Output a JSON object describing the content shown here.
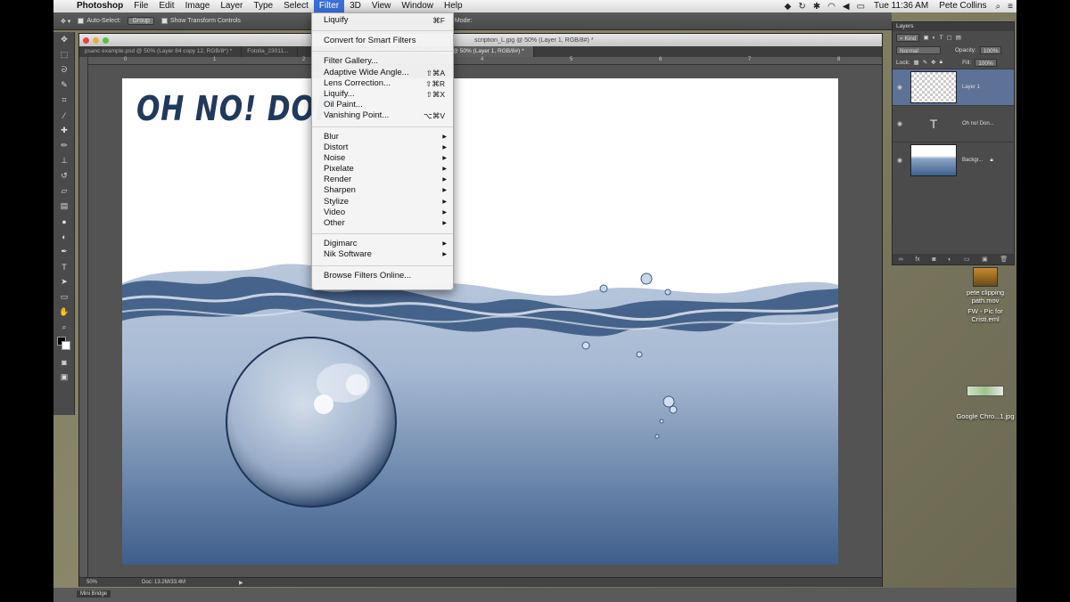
{
  "menubar": {
    "app": "Photoshop",
    "menus": [
      "File",
      "Edit",
      "Image",
      "Layer",
      "Type",
      "Select",
      "Filter",
      "3D",
      "View",
      "Window",
      "Help"
    ],
    "active_menu": "Filter",
    "clock": "Tue 11:36 AM",
    "user": "Pete Collins"
  },
  "options_bar": {
    "auto_select_label": "Auto-Select:",
    "auto_select_value": "Group",
    "transform_label": "Show Transform Controls",
    "mode_label": "Mode:"
  },
  "document": {
    "title": "scription_L.jpg @ 50% (Layer 1, RGB/8#) *",
    "tabs": [
      "psanc example.psd @ 50% (Layer 84 copy 12, RGB/8*) *",
      "Fotolia_23011...",
      "otolia_19823053_Subscription_L.jpg @ 50% (Layer 1, RGB/8#) *"
    ],
    "ruler_marks": [
      "0",
      "1",
      "2",
      "3",
      "4",
      "5",
      "6",
      "7",
      "8"
    ],
    "headline": "OH NO! DON",
    "zoom": "50%",
    "doc_size": "Doc: 13.2M/33.4M"
  },
  "filter_menu": {
    "groups": [
      [
        {
          "label": "Liquify",
          "shortcut": "⌘F"
        }
      ],
      [
        {
          "label": "Convert for Smart Filters"
        }
      ],
      [
        {
          "label": "Filter Gallery..."
        },
        {
          "label": "Adaptive Wide Angle...",
          "shortcut": "⇧⌘A"
        },
        {
          "label": "Lens Correction...",
          "shortcut": "⇧⌘R"
        },
        {
          "label": "Liquify...",
          "shortcut": "⇧⌘X"
        },
        {
          "label": "Oil Paint..."
        },
        {
          "label": "Vanishing Point...",
          "shortcut": "⌥⌘V"
        }
      ],
      [
        {
          "label": "Blur",
          "submenu": true
        },
        {
          "label": "Distort",
          "submenu": true
        },
        {
          "label": "Noise",
          "submenu": true
        },
        {
          "label": "Pixelate",
          "submenu": true
        },
        {
          "label": "Render",
          "submenu": true
        },
        {
          "label": "Sharpen",
          "submenu": true
        },
        {
          "label": "Stylize",
          "submenu": true
        },
        {
          "label": "Video",
          "submenu": true
        },
        {
          "label": "Other",
          "submenu": true
        }
      ],
      [
        {
          "label": "Digimarc",
          "submenu": true
        },
        {
          "label": "Nik Software",
          "submenu": true
        }
      ],
      [
        {
          "label": "Browse Filters Online..."
        }
      ]
    ]
  },
  "layers_panel": {
    "title": "Layers",
    "kind_label": "Kind",
    "blend_mode": "Normal",
    "opacity_label": "Opacity:",
    "opacity_value": "100%",
    "lock_label": "Lock:",
    "fill_label": "Fill:",
    "fill_value": "100%",
    "layers": [
      {
        "name": "Layer 1",
        "selected": true
      },
      {
        "name": "Oh no! Don..."
      },
      {
        "name": "Backgr..."
      }
    ]
  },
  "desktop": {
    "icons": [
      "pete clipping path.mov",
      "FW - Pic for Cristi.eml",
      "Google Chro...1.jpg"
    ]
  },
  "taskbar": {
    "label": "Mini Bridge"
  },
  "colors": {
    "menu_highlight": "#3a6fd9",
    "layer_selected": "#5d7296",
    "headline": "#213a5c"
  }
}
